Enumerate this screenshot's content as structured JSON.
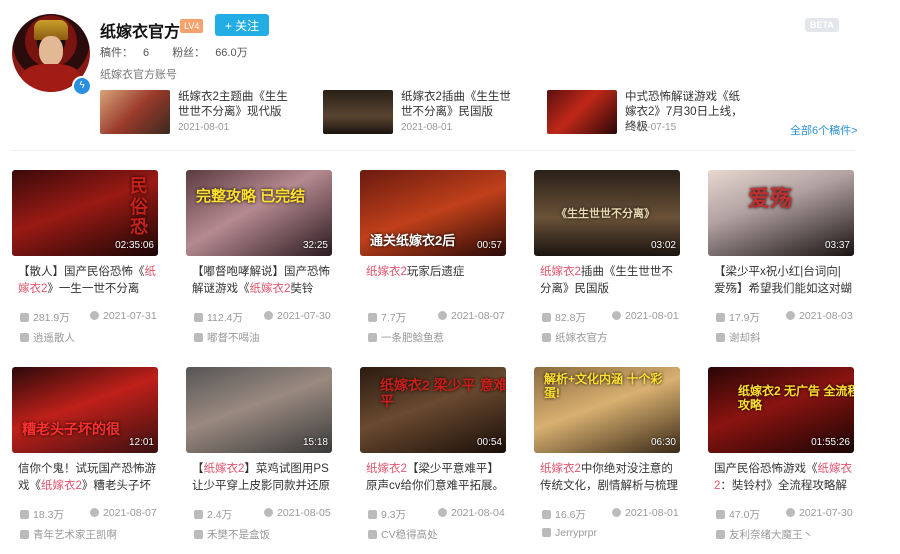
{
  "profile": {
    "name": "纸嫁衣官方",
    "level": "LV4",
    "follow_label": "+ 关注",
    "beta": "BETA",
    "works_label": "稿件：",
    "works": "6",
    "fans_label": "粉丝：",
    "fans": "66.0万",
    "signature": "纸嫁衣官方账号"
  },
  "recent": [
    {
      "title": "纸嫁衣2主题曲《生生世世不分离》现代版",
      "date": "2021-08-01"
    },
    {
      "title": "纸嫁衣2插曲《生生世世不分离》民国版",
      "date": "2021-08-01"
    },
    {
      "title": "中式恐怖解谜游戏《纸嫁衣2》7月30日上线，终极",
      "date": "2021-07-15"
    }
  ],
  "all_works": "全部6个稿件>",
  "cards": [
    {
      "pre": "【散人】国产民俗恐怖《",
      "hl": "纸嫁衣2",
      "post": "》一生一世不分离",
      "duration": "02:35:06",
      "plays": "281.9万",
      "date": "2021-07-31",
      "author": "逍遥散人",
      "cover_text": "民俗恐"
    },
    {
      "pre": "【嘟督咆哮解说】国产恐怖解谜游戏《",
      "hl": "纸嫁衣2",
      "post": "奘铃",
      "duration": "32:25",
      "plays": "112.4万",
      "date": "2021-07-30",
      "author": "嘟督不喝油",
      "cover_text": "完整攻略 已完结"
    },
    {
      "pre": "",
      "hl": "纸嫁衣2",
      "post": "玩家后遗症",
      "duration": "00:57",
      "plays": "7.7万",
      "date": "2021-08-07",
      "author": "一条肥鲶鱼惹",
      "cover_text": "通关纸嫁衣2后"
    },
    {
      "pre": "",
      "hl": "纸嫁衣2",
      "post": "插曲《生生世世不分离》民国版",
      "duration": "03:02",
      "plays": "82.8万",
      "date": "2021-08-01",
      "author": "纸嫁衣官方",
      "cover_text": "《生生世世不分离》"
    },
    {
      "pre": "【梁少平x祝小红|台词向|爱殇】希望我们能如这对蝴",
      "hl": "",
      "post": "",
      "duration": "03:37",
      "plays": "17.9万",
      "date": "2021-08-03",
      "author": "谢却斜",
      "cover_text": "爱殇"
    },
    {
      "pre": "信你个鬼！试玩国产恐怖游戏《",
      "hl": "纸嫁衣2",
      "post": "》糟老头子坏",
      "duration": "12:01",
      "plays": "18.3万",
      "date": "2021-08-07",
      "author": "青年艺术家王凯啊",
      "cover_text": "糟老头子坏的很"
    },
    {
      "pre": "【",
      "hl": "纸嫁衣2",
      "post": "】菜鸡试图用PS让少平穿上皮影同款并还原",
      "duration": "15:18",
      "plays": "2.4万",
      "date": "2021-08-05",
      "author": "禾樊不是盒饭",
      "cover_text": ""
    },
    {
      "pre": "",
      "hl": "纸嫁衣2",
      "post": "【梁少平意难平】原声cv给你们意难平拓展。",
      "duration": "00:54",
      "plays": "9.3万",
      "date": "2021-08-04",
      "author": "CV稳得高处",
      "cover_text": "纸嫁衣2 梁少平 意难平"
    },
    {
      "pre": "",
      "hl": "纸嫁衣2",
      "post": "中你绝对没注意的传统文化，剧情解析与梳理",
      "duration": "06:30",
      "plays": "16.6万",
      "date": "2021-08-01",
      "author": "Jerryprpr",
      "cover_text": "解析+文化内涵 十个彩蛋!"
    },
    {
      "pre": "国产民俗恐怖游戏《",
      "hl": "纸嫁衣2",
      "post": "：奘铃村》全流程攻略解",
      "duration": "01:55:26",
      "plays": "47.0万",
      "date": "2021-07-30",
      "author": "友利奈绪大魔王丶",
      "cover_text": "纸嫁衣2 无广告 全流程攻略"
    }
  ],
  "colors": {
    "accent": "#23ade5",
    "highlight": "#e0546c",
    "link": "#2a8fd4"
  }
}
